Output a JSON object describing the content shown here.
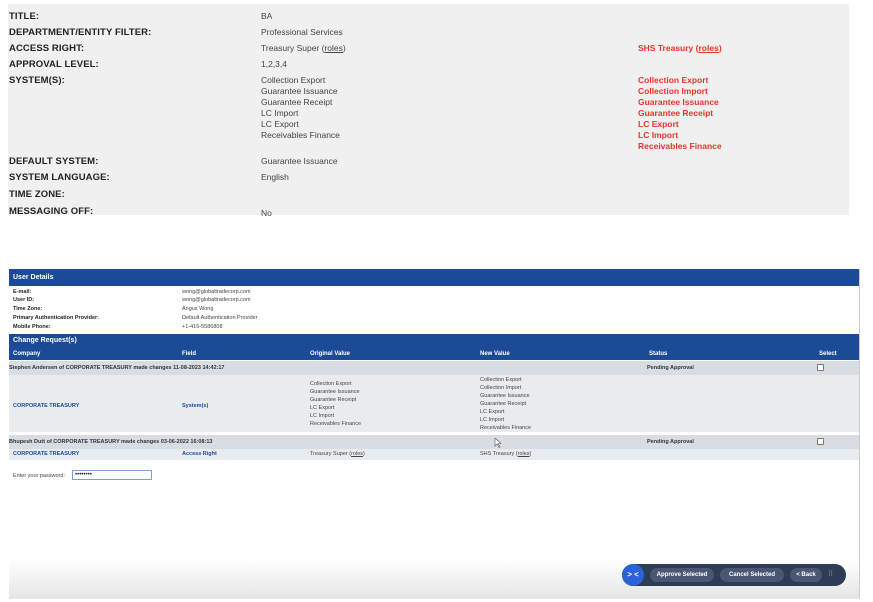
{
  "top_panel": {
    "title": {
      "label": "TITLE:",
      "value": "BA"
    },
    "department": {
      "label": "DEPARTMENT/ENTITY FILTER:",
      "value": "Professional Services"
    },
    "access_right": {
      "label": "ACCESS RIGHT:",
      "value": "Treasury Super",
      "value_link": "roles",
      "new_value": "SHS Treasury",
      "new_link": "roles"
    },
    "approval_level": {
      "label": "APPROVAL LEVEL:",
      "value": "1,2,3,4"
    },
    "systems": {
      "label": "SYSTEM(S):",
      "values": [
        "Collection Export",
        "Guarantee Issuance",
        "Guarantee Receipt",
        "LC Import",
        "LC Export",
        "Receivables Finance"
      ],
      "new_values": [
        "Collection Export",
        "Collection Import",
        "Guarantee Issuance",
        "Guarantee Receipt",
        "LC Export",
        "LC Import",
        "Receivables Finance"
      ]
    },
    "default_system": {
      "label": "DEFAULT SYSTEM:",
      "value": "Guarantee Issuance"
    },
    "system_language": {
      "label": "SYSTEM LANGUAGE:",
      "value": "English"
    },
    "time_zone": {
      "label": "TIME ZONE:",
      "value": ""
    },
    "messaging_off": {
      "label": "MESSAGING OFF:",
      "value": "No"
    }
  },
  "user_details": {
    "header": "User Details",
    "email": {
      "label": "E-mail:",
      "value": "wong@globaltradecorp.com"
    },
    "user_id": {
      "label": "User ID:",
      "value": "wong@globaltradecorp.com"
    },
    "time_zone": {
      "label": "Time Zone:",
      "value": "Angus Wong"
    },
    "auth_provider": {
      "label": "Primary Authentication Provider:",
      "value": "Default Authentication Provider"
    },
    "mobile": {
      "label": "Mobile Phone:",
      "value": "+1-416-5586808"
    }
  },
  "change_requests": {
    "header": "Change Request(s)",
    "columns": [
      "Company",
      "Field",
      "Original Value",
      "New Value",
      "Status",
      "Select"
    ],
    "groups": [
      {
        "heading": "Stephen Andersen of CORPORATE TREASURY made changes 11-08-2023 14:42:17",
        "status": "Pending Approval",
        "company": "CORPORATE TREASURY",
        "field": "System(s)",
        "original": [
          "Collection Export",
          "Guarantee Issuance",
          "Guarantee Receipt",
          "LC Export",
          "LC Import",
          "Receivables Finance"
        ],
        "new": [
          "Collection Export",
          "Collection Import",
          "Guarantee Issuance",
          "Guarantee Receipt",
          "LC Export",
          "LC Import",
          "Receivables Finance"
        ]
      },
      {
        "heading": "Bhupesh Dutt of CORPORATE TREASURY made changes 03-06-2022 16:08:13",
        "status": "Pending Approval",
        "company": "CORPORATE TREASURY",
        "field": "Access Right",
        "original": "Treasury Super",
        "original_link": "roles",
        "new": "SHS Treasury",
        "new_link": "roles"
      }
    ]
  },
  "password": {
    "label": "Enter your password:",
    "value": "••••••••"
  },
  "actions": {
    "toggle": "> <",
    "approve": "Approve Selected",
    "cancel": "Cancel Selected",
    "back": "< Back"
  },
  "icons": {
    "grip": "grip-icon",
    "cursor": "mouse-cursor-icon"
  },
  "colors": {
    "brand_blue": "#1b4a97",
    "changed_red": "#e8352b",
    "group_bg": "#d8dde3",
    "action_bar": "#2f3c55"
  }
}
